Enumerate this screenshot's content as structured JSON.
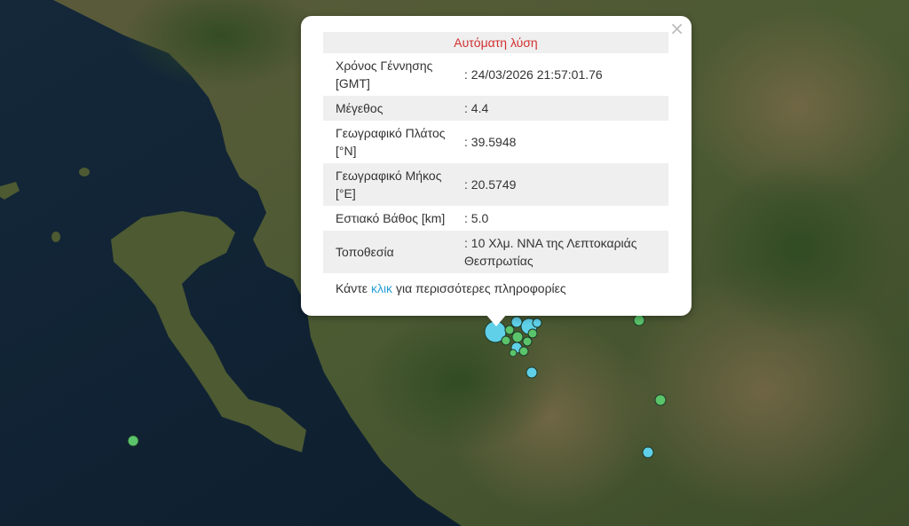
{
  "popup": {
    "close_label": "×",
    "header": "Αυτόματη λύση",
    "rows": [
      {
        "label": "Χρόνος Γέννησης [GMT]",
        "value": ": 24/03/2026 21:57:01.76"
      },
      {
        "label": "Μέγεθος",
        "value": ": 4.4"
      },
      {
        "label": "Γεωγραφικό Πλάτος [°N]",
        "value": ": 39.5948"
      },
      {
        "label": "Γεωγραφικό Μήκος [°E]",
        "value": ": 20.5749"
      },
      {
        "label": "Εστιακό Βάθος [km]",
        "value": ": 5.0"
      },
      {
        "label": "Τοποθεσία",
        "value": ": 10 Χλμ. ΝΝΑ της Λεπτοκαριάς Θεσπρωτίας"
      }
    ],
    "more_prefix": "Κάντε",
    "more_link": "κλικ",
    "more_suffix": "για περισσότερες πληροφορίες"
  },
  "colors": {
    "sea": "#0e2233",
    "land": "#4c5a30",
    "header_text": "#d32f2f",
    "link": "#2a9fd6",
    "quake_blue": "#5fd0e8",
    "quake_green": "#5bc36a"
  }
}
